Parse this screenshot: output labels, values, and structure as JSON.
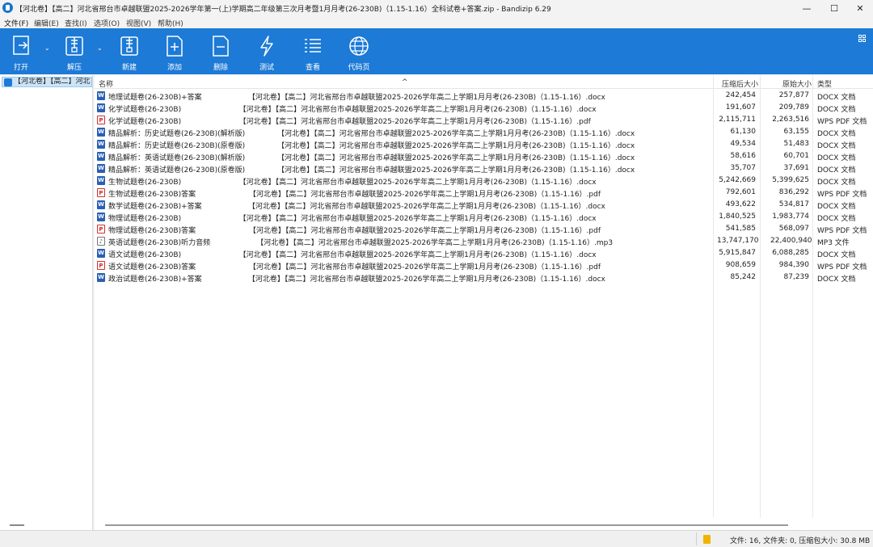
{
  "window": {
    "title_left": "【河北卷】【高二】河北省邢台市卓越联盟2025-2026学年第一(上)学期高二年级第三次月考暨1月月考(26-230B)（1.15-1.16）",
    "title_center": "全科试卷+答案.zip - Bandizip 6.29",
    "minimize": "—",
    "maximize": "☐",
    "close": "✕"
  },
  "menu": {
    "file": "文件(F)",
    "edit": "编辑(E)",
    "find": "查找(I)",
    "options": "选项(O)",
    "view": "视图(V)",
    "help": "帮助(H)"
  },
  "toolbar": {
    "open": "打开",
    "extract": "解压",
    "new": "新建",
    "add": "添加",
    "delete": "删除",
    "test": "测试",
    "view": "查看",
    "codepage": "代码页"
  },
  "tree": {
    "root": "【河北卷】【高二】河北"
  },
  "columns": {
    "name": "名称",
    "compressed": "压缩后大小",
    "original": "原始大小",
    "type": "类型"
  },
  "files": [
    {
      "name": "地理试题卷(26-230B)+答案                    【河北卷】【高二】河北省邢台市卓越联盟2025-2026学年高二上学期1月月考(26-230B)（1.15-1.16）.docx",
      "icon": "docx",
      "compressed": "242,454",
      "original": "257,877",
      "type": "DOCX 文档"
    },
    {
      "name": "化学试题卷(26-230B)                         【河北卷】【高二】河北省邢台市卓越联盟2025-2026学年高二上学期1月月考(26-230B)（1.15-1.16）.docx",
      "icon": "docx",
      "compressed": "191,607",
      "original": "209,789",
      "type": "DOCX 文档"
    },
    {
      "name": "化学试题卷(26-230B)                         【河北卷】【高二】河北省邢台市卓越联盟2025-2026学年高二上学期1月月考(26-230B)（1.15-1.16）.pdf",
      "icon": "pdf",
      "compressed": "2,115,711",
      "original": "2,263,516",
      "type": "WPS PDF 文档"
    },
    {
      "name": "精品解析：历史试题卷(26-230B)(解析版)              【河北卷】【高二】河北省邢台市卓越联盟2025-2026学年高二上学期1月月考(26-230B)（1.15-1.16）.docx",
      "icon": "docx",
      "compressed": "61,130",
      "original": "63,155",
      "type": "DOCX 文档"
    },
    {
      "name": "精品解析：历史试题卷(26-230B)(原卷版)              【河北卷】【高二】河北省邢台市卓越联盟2025-2026学年高二上学期1月月考(26-230B)（1.15-1.16）.docx",
      "icon": "docx",
      "compressed": "49,534",
      "original": "51,483",
      "type": "DOCX 文档"
    },
    {
      "name": "精品解析：英语试题卷(26-230B)(解析版)              【河北卷】【高二】河北省邢台市卓越联盟2025-2026学年高二上学期1月月考(26-230B)（1.15-1.16）.docx",
      "icon": "docx",
      "compressed": "58,616",
      "original": "60,701",
      "type": "DOCX 文档"
    },
    {
      "name": "精品解析：英语试题卷(26-230B)(原卷版)              【河北卷】【高二】河北省邢台市卓越联盟2025-2026学年高二上学期1月月考(26-230B)（1.15-1.16）.docx",
      "icon": "docx",
      "compressed": "35,707",
      "original": "37,691",
      "type": "DOCX 文档"
    },
    {
      "name": "生物试题卷(26-230B)                         【河北卷】【高二】河北省邢台市卓越联盟2025-2026学年高二上学期1月月考(26-230B)（1.15-1.16）.docx",
      "icon": "docx",
      "compressed": "5,242,669",
      "original": "5,399,625",
      "type": "DOCX 文档"
    },
    {
      "name": "生物试题卷(26-230B)答案                       【河北卷】【高二】河北省邢台市卓越联盟2025-2026学年高二上学期1月月考(26-230B)（1.15-1.16）.pdf",
      "icon": "pdf",
      "compressed": "792,601",
      "original": "836,292",
      "type": "WPS PDF 文档"
    },
    {
      "name": "数学试题卷(26-230B)+答案                    【河北卷】【高二】河北省邢台市卓越联盟2025-2026学年高二上学期1月月考(26-230B)（1.15-1.16）.docx",
      "icon": "docx",
      "compressed": "493,622",
      "original": "534,817",
      "type": "DOCX 文档"
    },
    {
      "name": "物理试题卷(26-230B)                         【河北卷】【高二】河北省邢台市卓越联盟2025-2026学年高二上学期1月月考(26-230B)（1.15-1.16）.docx",
      "icon": "docx",
      "compressed": "1,840,525",
      "original": "1,983,774",
      "type": "DOCX 文档"
    },
    {
      "name": "物理试题卷(26-230B)答案                       【河北卷】【高二】河北省邢台市卓越联盟2025-2026学年高二上学期1月月考(26-230B)（1.15-1.16）.pdf",
      "icon": "pdf",
      "compressed": "541,585",
      "original": "568,097",
      "type": "WPS PDF 文档"
    },
    {
      "name": "英语试题卷(26-230B)听力音频                    【河北卷】【高二】河北省邢台市卓越联盟2025-2026学年高二上学期1月月考(26-230B)（1.15-1.16）.mp3",
      "icon": "mp3",
      "compressed": "13,747,170",
      "original": "22,400,940",
      "type": "MP3 文件"
    },
    {
      "name": "语文试题卷(26-230B)                         【河北卷】【高二】河北省邢台市卓越联盟2025-2026学年高二上学期1月月考(26-230B)（1.15-1.16）.docx",
      "icon": "docx",
      "compressed": "5,915,847",
      "original": "6,088,285",
      "type": "DOCX 文档"
    },
    {
      "name": "语文试题卷(26-230B)答案                       【河北卷】【高二】河北省邢台市卓越联盟2025-2026学年高二上学期1月月考(26-230B)（1.15-1.16）.pdf",
      "icon": "pdf",
      "compressed": "908,659",
      "original": "984,390",
      "type": "WPS PDF 文档"
    },
    {
      "name": "政治试题卷(26-230B)+答案                    【河北卷】【高二】河北省邢台市卓越联盟2025-2026学年高二上学期1月月考(26-230B)（1.15-1.16）.docx",
      "icon": "docx",
      "compressed": "85,242",
      "original": "87,239",
      "type": "DOCX 文档"
    }
  ],
  "status": {
    "summary": "文件: 16, 文件夹: 0, 压缩包大小: 30.8 MB"
  },
  "colors": {
    "toolbar": "#1d7ad6",
    "selection": "#cce4f7",
    "docx_icon": "#2a5fb4",
    "pdf_icon": "#d12f2f"
  }
}
